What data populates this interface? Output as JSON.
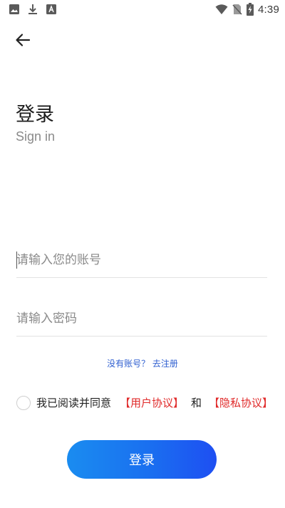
{
  "status_bar": {
    "time": "4:39",
    "icons_left": [
      "image-icon",
      "download-icon",
      "text-box-icon"
    ],
    "icons_right": [
      "wifi-icon",
      "no-sim-icon",
      "battery-charging-icon"
    ]
  },
  "header": {
    "back_icon": "arrow-left-icon"
  },
  "title": {
    "main": "登录",
    "sub": "Sign in"
  },
  "form": {
    "account_placeholder": "请输入您的账号",
    "password_placeholder": "请输入密码"
  },
  "register": {
    "prompt": "没有账号？",
    "link": "去注册"
  },
  "agreement": {
    "checked": false,
    "prefix": "我已阅读并同意",
    "user_agreement": "【用户协议】",
    "conj": "和",
    "privacy_agreement": "【隐私协议】"
  },
  "login_button": {
    "label": "登录"
  },
  "colors": {
    "accent_blue": "#1a6ff0",
    "link_red": "#e02a2a",
    "link_blue": "#2f5fd0",
    "placeholder_gray": "#8a8a8a"
  }
}
